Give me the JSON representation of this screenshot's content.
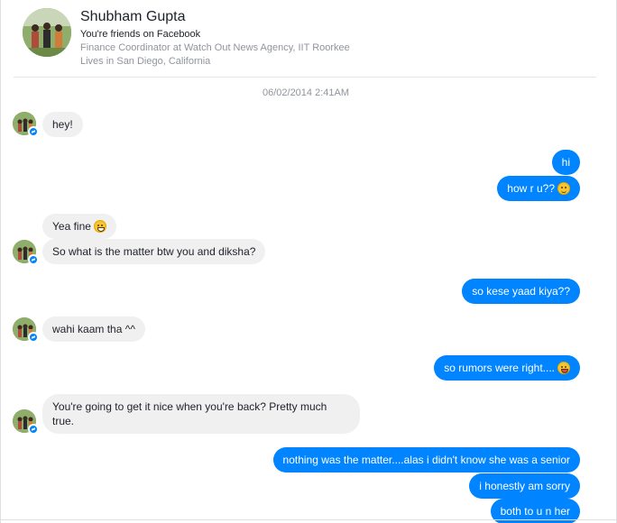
{
  "profile": {
    "name": "Shubham Gupta",
    "friend_status": "You're friends on Facebook",
    "work": "Finance Coordinator at Watch Out News Agency, IIT Roorkee",
    "location": "Lives in San Diego, California"
  },
  "thread": {
    "timestamp": "06/02/2014 2:41AM",
    "messages": [
      {
        "from": "them",
        "text": "hey!"
      },
      {
        "from": "me",
        "text": "hi"
      },
      {
        "from": "me",
        "text": "how r u??",
        "emoji": "smile-emoji-icon"
      },
      {
        "from": "them",
        "text": "Yea fine",
        "emoji": "grin-emoji-icon"
      },
      {
        "from": "them",
        "text": "So what is the matter btw you and diksha?"
      },
      {
        "from": "me",
        "text": "so kese yaad kiya??"
      },
      {
        "from": "them",
        "text": "wahi kaam tha ^^"
      },
      {
        "from": "me",
        "text": "so rumors were right....",
        "emoji": "tongue-emoji-icon"
      },
      {
        "from": "them",
        "text": "You're going to get it nice when you're back? Pretty much true."
      },
      {
        "from": "me",
        "text": "nothing was the matter....alas i didn't know she was a senior"
      },
      {
        "from": "me",
        "text": "i honestly am sorry"
      },
      {
        "from": "me",
        "text": "both to u n her"
      }
    ]
  },
  "colors": {
    "outgoing_bubble": "#0084ff",
    "incoming_bubble": "#f1f0f0",
    "secondary_text": "#90949c"
  }
}
